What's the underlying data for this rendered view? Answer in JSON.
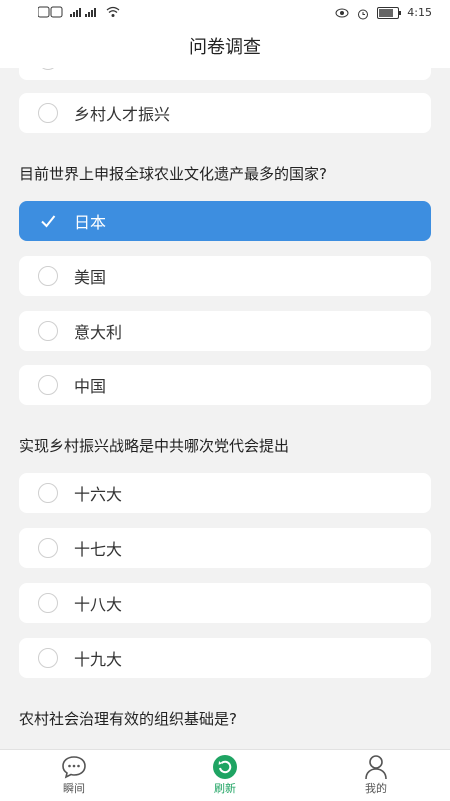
{
  "status": {
    "time": "4:15",
    "battery": "100"
  },
  "header": {
    "title": "问卷调查"
  },
  "options_top": [
    {
      "label": "乡村人才振兴"
    }
  ],
  "questions": [
    {
      "text": "目前世界上申报全球农业文化遗产最多的国家?",
      "options": [
        "日本",
        "美国",
        "意大利",
        "中国"
      ],
      "selected": 0
    },
    {
      "text": "实现乡村振兴战略是中共哪次党代会提出",
      "options": [
        "十六大",
        "十七大",
        "十八大",
        "十九大"
      ]
    },
    {
      "text": "农村社会治理有效的组织基础是?"
    }
  ],
  "tabs": [
    {
      "label": "瞬间",
      "icon": "chat-bubble-icon"
    },
    {
      "label": "刷新",
      "icon": "refresh-icon"
    },
    {
      "label": "我的",
      "icon": "person-icon"
    }
  ],
  "colors": {
    "selected": "#3d8ee0",
    "tab_active": "#1fa463"
  }
}
